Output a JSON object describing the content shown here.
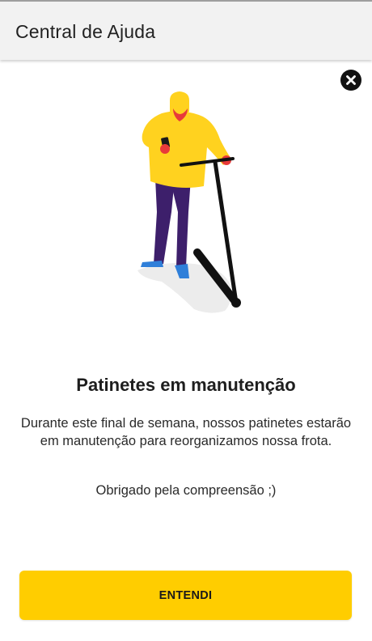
{
  "app_bar": {
    "title": "Central de Ajuda"
  },
  "modal": {
    "close_icon": "close-icon",
    "illustration": "person-with-scooter-illustration",
    "title": "Patinetes em manutenção",
    "message": "Durante este final de semana, nossos patinetes estarão em manutenção para reorganizamos nossa frota.",
    "thanks": "Obrigado pela compreensão ;)",
    "confirm_label": "ENTENDI"
  },
  "colors": {
    "accent": "#FFCD00",
    "app_bar_bg": "#F2F2F2",
    "text": "#222222",
    "close_button": "#111111",
    "illustration_jacket": "#FFD21F",
    "illustration_pants": "#3D1F6B",
    "illustration_hands": "#E83A3A",
    "illustration_shoes": "#2F7FD9"
  }
}
